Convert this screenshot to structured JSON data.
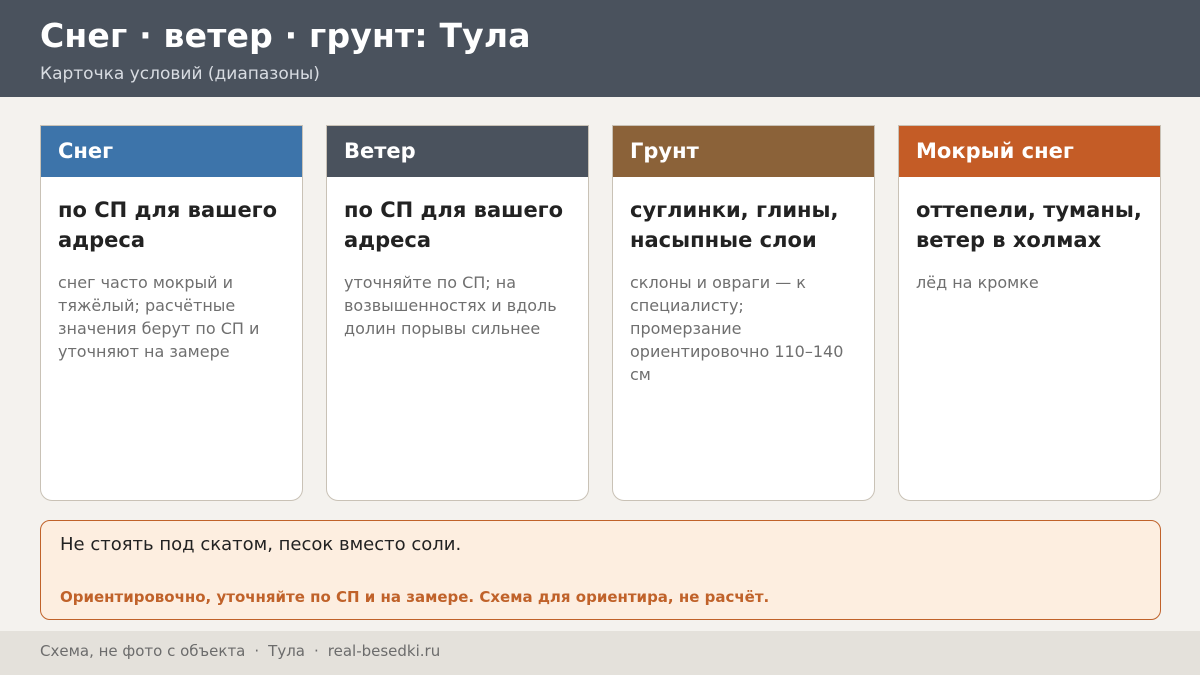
{
  "header": {
    "title": "Снег · ветер · грунт: Тула",
    "subtitle": "Карточка условий (диапазоны)"
  },
  "cards": [
    {
      "title": "Снег",
      "main": "по СП для вашего адреса",
      "note": "снег часто мокрый и тяжёлый; расчётные значения берут по СП и уточняют на замере",
      "color": "#3d74aa"
    },
    {
      "title": "Ветер",
      "main": "по СП для вашего адреса",
      "note": "уточняйте по СП; на возвышенностях и вдоль долин порывы сильнее",
      "color": "#4a525d"
    },
    {
      "title": "Грунт",
      "main": "суглинки, глины, насыпные слои",
      "note": "склоны и овраги — к специалисту; промерзание ориентировочно 110–140 см",
      "color": "#8b6239"
    },
    {
      "title": "Мокрый снег",
      "main": "оттепели, туманы, ветер в холмах",
      "note": "лёд на кромке",
      "color": "#c45c26"
    }
  ],
  "banner": {
    "text": "Не стоять под скатом, песок вместо соли.",
    "warning": "Ориентировочно, уточняйте по СП и на замере. Схема для ориентира, не расчёт."
  },
  "footer": {
    "items": [
      "Схема, не фото с объекта",
      "Тула",
      "real-besedki.ru"
    ],
    "separator": "·"
  },
  "colors": {
    "header_bg": "#4a525d",
    "accent": "#c0622a",
    "banner_bg": "#fdeee0"
  }
}
